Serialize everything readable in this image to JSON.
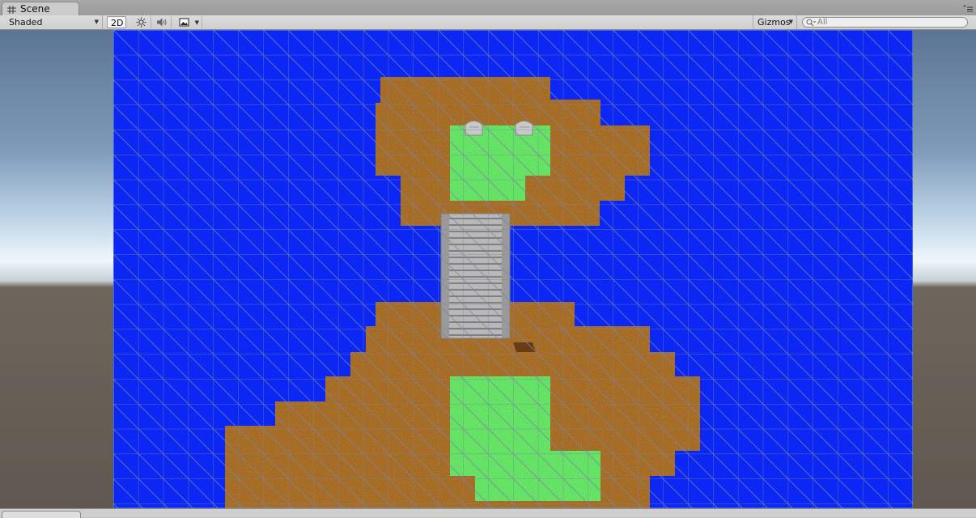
{
  "tab": {
    "label": "Scene",
    "icon": "scene-grid-icon"
  },
  "toolbar": {
    "draw_mode": "Shaded",
    "mode_2d": "2D",
    "lighting_icon": "sun-icon",
    "audio_icon": "speaker-icon",
    "effects_icon": "image-icon",
    "gizmos": "Gizmos",
    "search_placeholder": "All"
  },
  "colors": {
    "water": "#0a14f0",
    "dirt": "#7a4318",
    "grass": "#2fd62f",
    "bridge": "#b8b8b8",
    "grid_line": "#6c7894"
  },
  "scene_objects": [
    "water-tilemap",
    "dirt-island-north",
    "dirt-island-south",
    "grass-patch-north",
    "grass-patch-south",
    "wooden-bridge",
    "gravestone-left",
    "gravestone-right"
  ]
}
